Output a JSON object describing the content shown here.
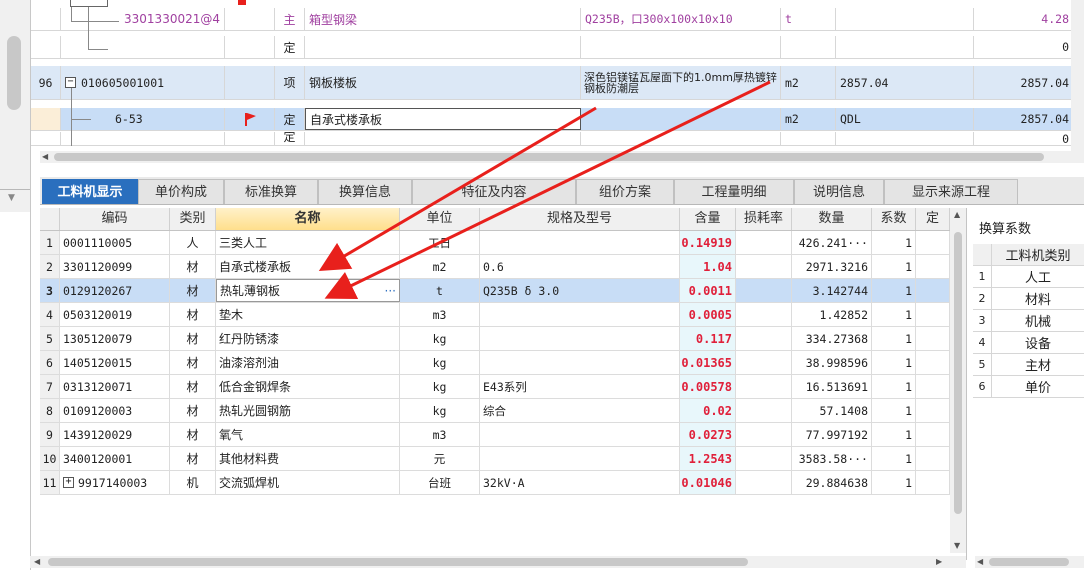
{
  "upper_rows": [
    {
      "code": "3301330021@4",
      "type": "主",
      "name": "箱型钢梁",
      "spec": "Q235B，口300x100x10x10",
      "unit": "t",
      "quantity": "",
      "value": "4.28"
    },
    {
      "code": "",
      "type": "定",
      "name": "",
      "spec": "",
      "unit": "",
      "quantity": "",
      "value": "0"
    },
    {
      "num": "96",
      "code": "010605001001",
      "type": "项",
      "name": "钢板楼板",
      "spec": "深色铝镁锰瓦屋面下的1.0mm厚热镀锌钢板防潮层",
      "unit": "m2",
      "quantity": "2857.04",
      "value": "2857.04"
    },
    {
      "code": "6-53",
      "type": "定",
      "name": "自承式楼承板",
      "spec": "",
      "unit": "m2",
      "quantity": "QDL",
      "value": "2857.04"
    },
    {
      "code": "",
      "type": "定",
      "name": "",
      "spec": "",
      "unit": "",
      "quantity": "",
      "value": "0"
    }
  ],
  "tabs": [
    "工料机显示",
    "单价构成",
    "标准换算",
    "换算信息",
    "特征及内容",
    "组价方案",
    "工程量明细",
    "说明信息",
    "显示来源工程"
  ],
  "grid": {
    "headers": [
      "编码",
      "类别",
      "名称",
      "单位",
      "规格及型号",
      "含量",
      "损耗率",
      "数量",
      "系数",
      "定"
    ],
    "rows": [
      {
        "num": "1",
        "code": "0001110005",
        "cat": "人",
        "name": "三类人工",
        "unit": "工日",
        "spec": "",
        "content": "0.14919",
        "loss": "",
        "qty": "426.241···",
        "coef": "1"
      },
      {
        "num": "2",
        "code": "3301120099",
        "cat": "材",
        "name": "自承式楼承板",
        "unit": "m2",
        "spec": "0.6",
        "content": "1.04",
        "loss": "",
        "qty": "2971.3216",
        "coef": "1"
      },
      {
        "num": "3",
        "code": "0129120267",
        "cat": "材",
        "name": "热轧薄钢板",
        "unit": "t",
        "spec": "Q235B δ 3.0",
        "content": "0.0011",
        "loss": "",
        "qty": "3.142744",
        "coef": "1"
      },
      {
        "num": "4",
        "code": "0503120019",
        "cat": "材",
        "name": "垫木",
        "unit": "m3",
        "spec": "",
        "content": "0.0005",
        "loss": "",
        "qty": "1.42852",
        "coef": "1"
      },
      {
        "num": "5",
        "code": "1305120079",
        "cat": "材",
        "name": "红丹防锈漆",
        "unit": "kg",
        "spec": "",
        "content": "0.117",
        "loss": "",
        "qty": "334.27368",
        "coef": "1"
      },
      {
        "num": "6",
        "code": "1405120015",
        "cat": "材",
        "name": "油漆溶剂油",
        "unit": "kg",
        "spec": "",
        "content": "0.01365",
        "loss": "",
        "qty": "38.998596",
        "coef": "1"
      },
      {
        "num": "7",
        "code": "0313120071",
        "cat": "材",
        "name": "低合金钢焊条",
        "unit": "kg",
        "spec": "E43系列",
        "content": "0.00578",
        "loss": "",
        "qty": "16.513691",
        "coef": "1"
      },
      {
        "num": "8",
        "code": "0109120003",
        "cat": "材",
        "name": "热轧光圆钢筋",
        "unit": "kg",
        "spec": "综合",
        "content": "0.02",
        "loss": "",
        "qty": "57.1408",
        "coef": "1"
      },
      {
        "num": "9",
        "code": "1439120029",
        "cat": "材",
        "name": "氧气",
        "unit": "m3",
        "spec": "",
        "content": "0.0273",
        "loss": "",
        "qty": "77.997192",
        "coef": "1"
      },
      {
        "num": "10",
        "code": "3400120001",
        "cat": "材",
        "name": "其他材料费",
        "unit": "元",
        "spec": "",
        "content": "1.2543",
        "loss": "",
        "qty": "3583.58···",
        "coef": "1"
      },
      {
        "num": "11",
        "code": "9917140003",
        "cat": "机",
        "name": "交流弧焊机",
        "unit": "台班",
        "spec": "32kV·A",
        "content": "0.01046",
        "loss": "",
        "qty": "29.884638",
        "coef": "1"
      }
    ]
  },
  "right_panel": {
    "title": "换算系数",
    "header": "工料机类别",
    "items": [
      {
        "num": "1",
        "label": "人工"
      },
      {
        "num": "2",
        "label": "材料"
      },
      {
        "num": "3",
        "label": "机械"
      },
      {
        "num": "4",
        "label": "设备"
      },
      {
        "num": "5",
        "label": "主材"
      },
      {
        "num": "6",
        "label": "单价"
      }
    ]
  },
  "icons": {
    "flag": "flag-icon",
    "expand": "plus-box-icon",
    "collapse": "minus-box-icon",
    "ellipsis": "ellipsis-icon"
  },
  "colors": {
    "tab_active": "#2a6fbe",
    "selected_row": "#c8ddf6",
    "content_red": "#e0203a",
    "arrow_red": "#e8201c",
    "flag_red": "#e8201c"
  }
}
